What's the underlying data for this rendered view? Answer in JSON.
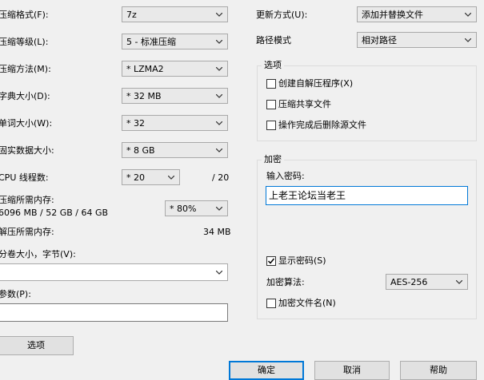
{
  "left": {
    "format_label": "压缩格式(F):",
    "format_value": "7z",
    "level_label": "压缩等级(L):",
    "level_value": "5 - 标准压缩",
    "method_label": "压缩方法(M):",
    "method_value": "* LZMA2",
    "dict_label": "字典大小(D):",
    "dict_value": "* 32 MB",
    "word_label": "单词大小(W):",
    "word_value": "* 32",
    "solid_label": "固实数据大小:",
    "solid_value": "* 8 GB",
    "threads_label": "CPU 线程数:",
    "threads_value": "* 20",
    "threads_total": "/ 20",
    "mem_comp_label": "压缩所需内存:",
    "mem_comp_detail": "6096 MB / 52 GB / 64 GB",
    "mem_comp_value": "* 80%",
    "mem_decomp_label": "解压所需内存:",
    "mem_decomp_value": "34 MB",
    "volume_label": "分卷大小，字节(V):",
    "volume_value": "",
    "params_label": "参数(P):",
    "params_value": "",
    "options_button": "选项"
  },
  "right": {
    "update_label": "更新方式(U):",
    "update_value": "添加并替换文件",
    "path_label": "路径模式",
    "path_value": "相对路径",
    "options_group": "选项",
    "opt_sfx": "创建自解压程序(X)",
    "opt_shared": "压缩共享文件",
    "opt_delete": "操作完成后删除源文件",
    "encrypt_group": "加密",
    "password_label": "输入密码:",
    "password_value": "上老王论坛当老王",
    "show_password": "显示密码(S)",
    "show_password_checked": true,
    "enc_method_label": "加密算法:",
    "enc_method_value": "AES-256",
    "encrypt_names": "加密文件名(N)"
  },
  "buttons": {
    "ok": "确定",
    "cancel": "取消",
    "help": "帮助"
  }
}
